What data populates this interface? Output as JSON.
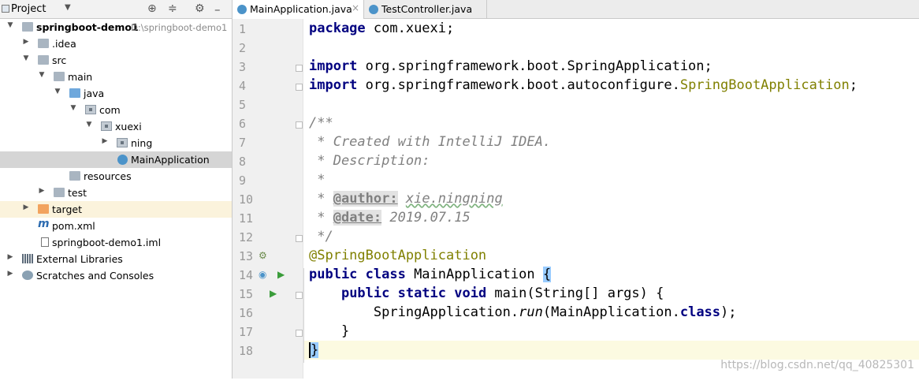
{
  "project_panel": {
    "title": "Project",
    "dropdown_icon": "chevron-down-icon",
    "buttons": [
      "crosshair-icon",
      "collapse-icon",
      "gear-icon",
      "minimize-icon"
    ]
  },
  "tree": [
    {
      "label": "springboot-demo1",
      "sublabel": "D:\\springboot-demo1",
      "bold": true
    },
    {
      "label": ".idea"
    },
    {
      "label": "src"
    },
    {
      "label": "main"
    },
    {
      "label": "java"
    },
    {
      "label": "com"
    },
    {
      "label": "xuexi"
    },
    {
      "label": "ning"
    },
    {
      "label": "MainApplication"
    },
    {
      "label": "resources"
    },
    {
      "label": "test"
    },
    {
      "label": "target"
    },
    {
      "label": "pom.xml"
    },
    {
      "label": "springboot-demo1.iml"
    },
    {
      "label": "External Libraries"
    },
    {
      "label": "Scratches and Consoles"
    }
  ],
  "tabs": [
    {
      "label": "MainApplication.java",
      "active": true
    },
    {
      "label": "TestController.java",
      "active": false
    }
  ],
  "line_numbers": [
    "1",
    "2",
    "3",
    "4",
    "5",
    "6",
    "7",
    "8",
    "9",
    "10",
    "11",
    "12",
    "13",
    "14",
    "15",
    "16",
    "17",
    "18"
  ],
  "code": {
    "l1": {
      "kw": "package",
      "rest": " com.xuexi;"
    },
    "l3": {
      "kw": "import",
      "rest": " org.springframework.boot.SpringApplication;"
    },
    "l4": {
      "kw": "import",
      "rest": " org.springframework.boot.autoconfigure.",
      "ann": "SpringBootApplication",
      "end": ";"
    },
    "l6": "/**",
    "l7": " * Created with IntelliJ IDEA.",
    "l8": " * Description:",
    "l9": " *",
    "l10": {
      "pre": " * ",
      "tag": "@author:",
      "space": " ",
      "val": "xie.ningning"
    },
    "l11": {
      "pre": " * ",
      "tag": "@date:",
      "space": " ",
      "val": "2019.07.15"
    },
    "l12": " */",
    "l13": "@SpringBootApplication",
    "l14": {
      "kw": "public class",
      "rest": " MainApplication ",
      "brace": "{"
    },
    "l15": {
      "indent": "    ",
      "kw": "public static void",
      "rest": " main(String[] args) {"
    },
    "l16": {
      "indent": "        ",
      "pre": "SpringApplication.",
      "ital": "run",
      "mid": "(MainApplication.",
      "kw": "class",
      "end": ");"
    },
    "l17": "    }",
    "l18": "}"
  },
  "watermark": "https://blog.csdn.net/qq_40825301"
}
